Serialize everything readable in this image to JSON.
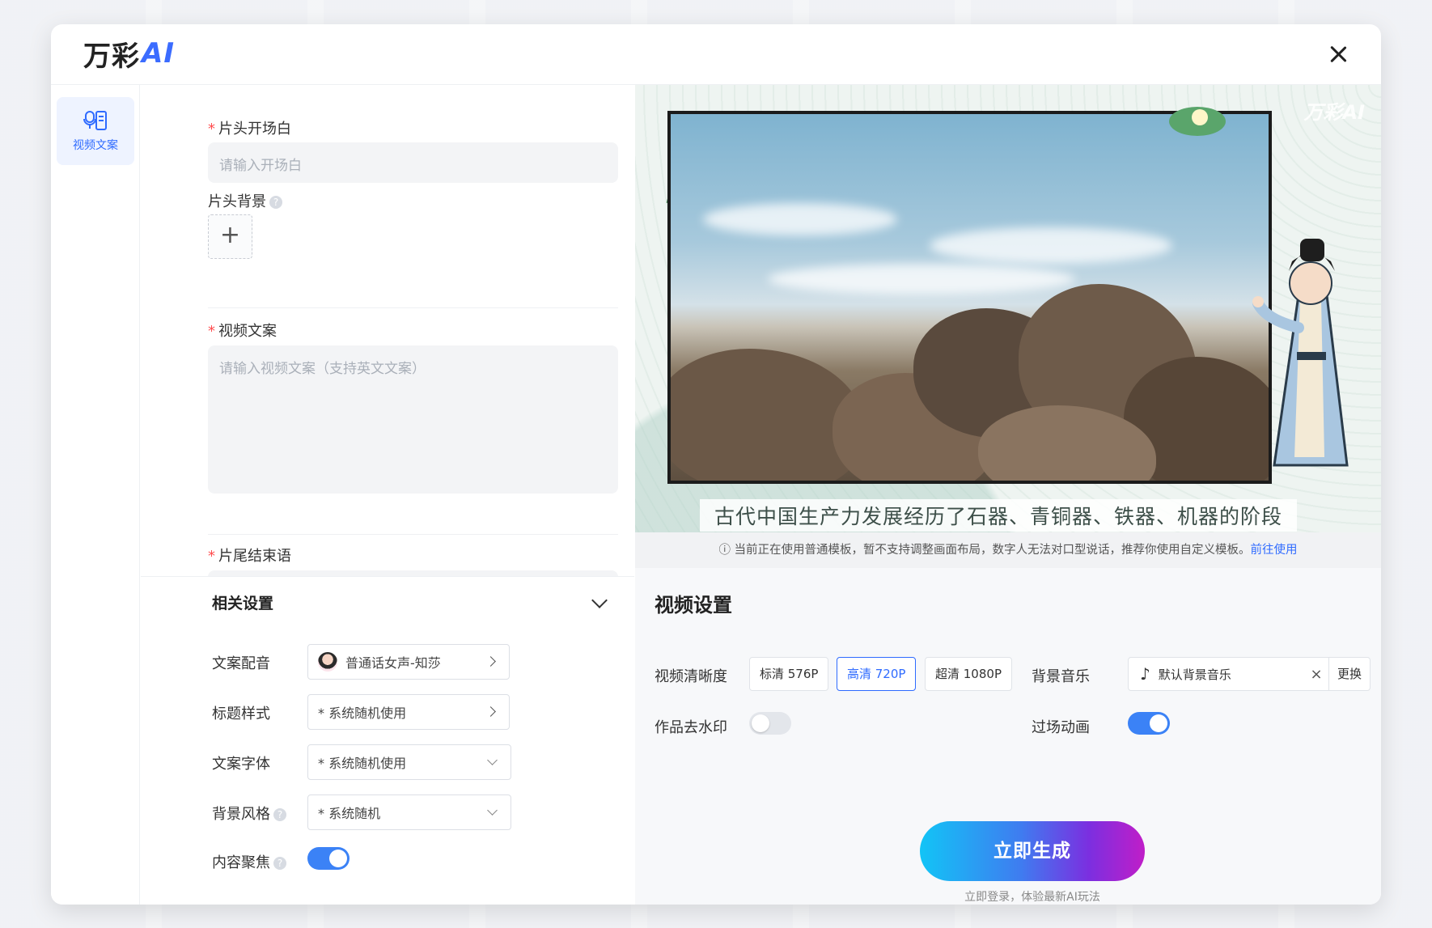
{
  "app": {
    "logo_text": "万彩",
    "logo_ai": "AI",
    "watermark": "万彩AI"
  },
  "sidebar": {
    "items": [
      {
        "label": "视频文案",
        "icon": "script-mic-icon"
      }
    ]
  },
  "form": {
    "opening": {
      "label": "片头开场白",
      "placeholder": "请输入开场白"
    },
    "opening_bg": {
      "label": "片头背景",
      "upload": "+"
    },
    "script": {
      "label": "视频文案",
      "placeholder": "请输入视频文案（支持英文文案）"
    },
    "ending": {
      "label": "片尾结束语"
    }
  },
  "settings": {
    "title": "相关设置",
    "voice": {
      "label": "文案配音",
      "value": "普通话女声-知莎"
    },
    "title_style": {
      "label": "标题样式",
      "value": "* 系统随机使用"
    },
    "font": {
      "label": "文案字体",
      "value": "* 系统随机使用"
    },
    "bg_style": {
      "label": "背景风格",
      "value": "* 系统随机"
    },
    "focus": {
      "label": "内容聚焦",
      "on": true
    }
  },
  "preview": {
    "subtitle": "古代中国生产力发展经历了石器、青铜器、铁器、机器的阶段",
    "notice": "当前正在使用普通模板，暂不支持调整画面布局，数字人无法对口型说话，推荐你使用自定义模板。",
    "notice_link": "前往使用"
  },
  "video_settings": {
    "title": "视频设置",
    "resolution_label": "视频清晰度",
    "resolutions": [
      "标清 576P",
      "高清 720P",
      "超清 1080P"
    ],
    "selected_resolution": "高清 720P",
    "music_label": "背景音乐",
    "music_value": "默认背景音乐",
    "music_change": "更换",
    "watermark_label": "作品去水印",
    "watermark_on": false,
    "transition_label": "过场动画",
    "transition_on": true,
    "generate": "立即生成",
    "generate_hint": "立即登录，体验最新AI玩法"
  },
  "colors": {
    "accent": "#2f6bff",
    "toggle_on": "#3b82f6",
    "required": "#ff4d4f"
  }
}
